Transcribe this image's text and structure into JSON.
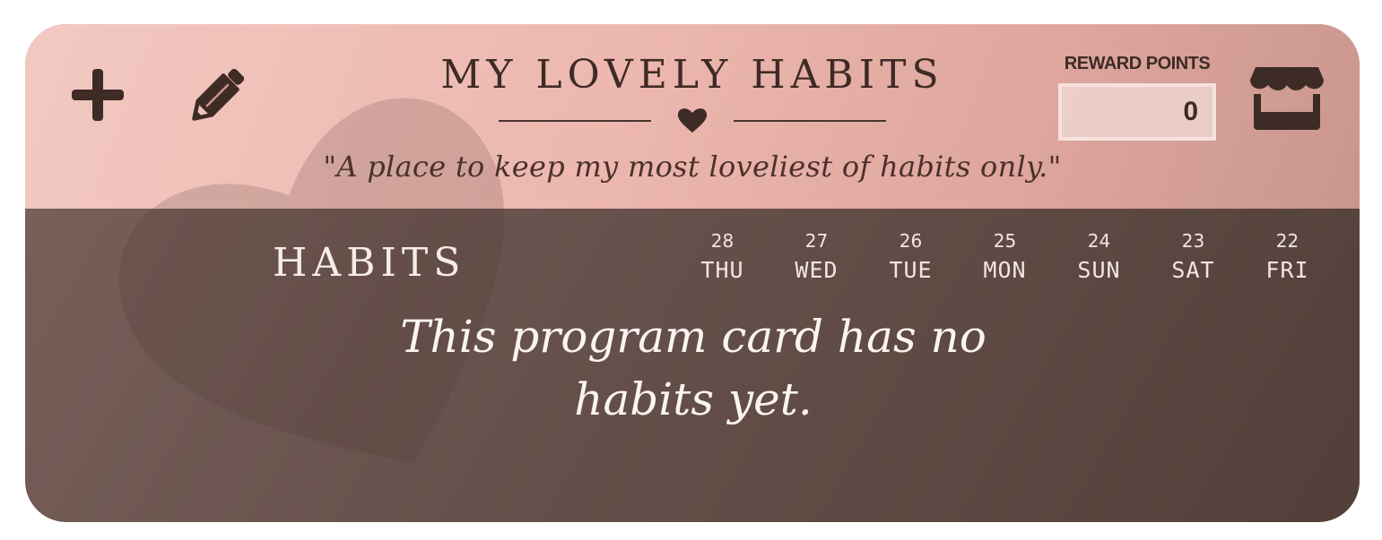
{
  "header": {
    "title": "MY LOVELY HABITS",
    "subtitle": "\"A place to keep my most loveliest of habits only.\"",
    "reward_label": "REWARD POINTS",
    "reward_points": "0"
  },
  "toolbar": {
    "add_icon": "plus-icon",
    "edit_icon": "pencil-icon",
    "store_icon": "storefront-icon"
  },
  "habits": {
    "title": "HABITS",
    "days": [
      {
        "num": "28",
        "name": "THU"
      },
      {
        "num": "27",
        "name": "WED"
      },
      {
        "num": "26",
        "name": "TUE"
      },
      {
        "num": "25",
        "name": "MON"
      },
      {
        "num": "24",
        "name": "SUN"
      },
      {
        "num": "23",
        "name": "SAT"
      },
      {
        "num": "22",
        "name": "FRI"
      }
    ],
    "empty_message": "This program card has no habits yet."
  },
  "colors": {
    "header_bg": "#ecb7ae",
    "body_bg": "#66504b",
    "text_dark": "#3f2b25",
    "text_light": "#f6ecea"
  }
}
